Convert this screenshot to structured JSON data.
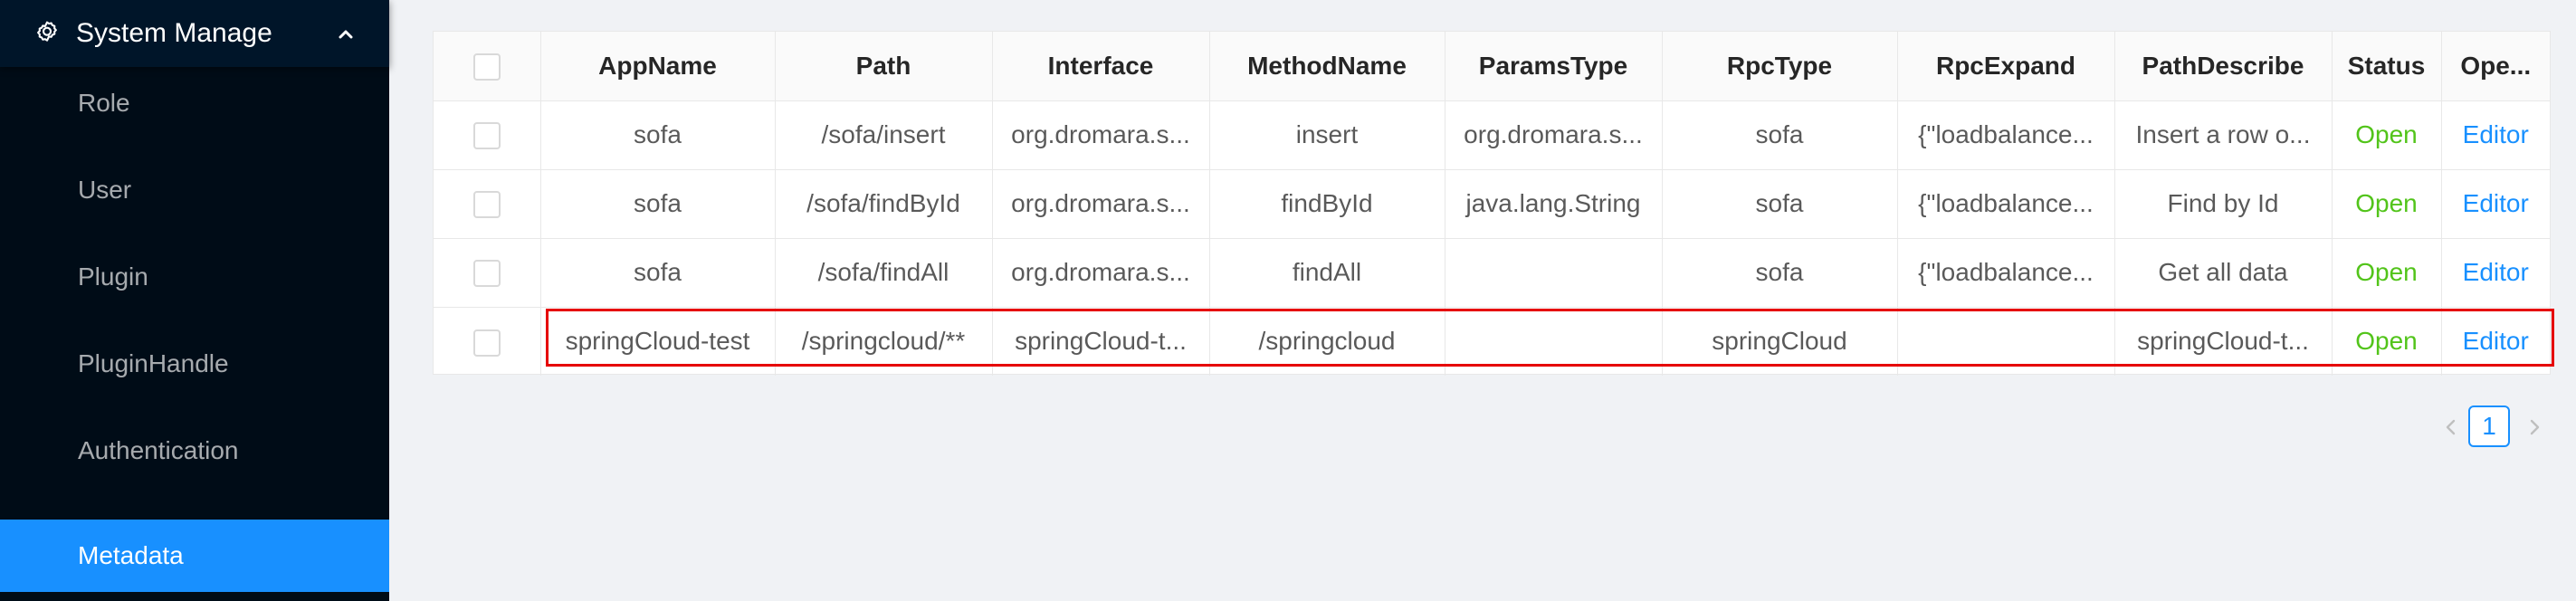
{
  "sidebar": {
    "header": {
      "title": "System Manage",
      "icon": "gear-icon",
      "caret_icon": "chevron-up-icon"
    },
    "items": [
      {
        "label": "Role",
        "selected": false
      },
      {
        "label": "User",
        "selected": false
      },
      {
        "label": "Plugin",
        "selected": false
      },
      {
        "label": "PluginHandle",
        "selected": false
      },
      {
        "label": "Authentication",
        "selected": false
      },
      {
        "label": "Metadata",
        "selected": true
      }
    ],
    "colors": {
      "background": "#001529",
      "selected": "#1890ff"
    }
  },
  "table": {
    "columns": [
      "AppName",
      "Path",
      "Interface",
      "MethodName",
      "ParamsType",
      "RpcType",
      "RpcExpand",
      "PathDescribe",
      "Status",
      "Ope..."
    ],
    "rows": [
      {
        "app_name": "sofa",
        "path": "/sofa/insert",
        "interface": "org.dromara.s...",
        "method_name": "insert",
        "params_type": "org.dromara.s...",
        "rpc_type": "sofa",
        "rpc_expand": "{\"loadbalance...",
        "path_describe": "Insert a row o...",
        "status": "Open",
        "operation": "Editor",
        "highlighted": false
      },
      {
        "app_name": "sofa",
        "path": "/sofa/findById",
        "interface": "org.dromara.s...",
        "method_name": "findById",
        "params_type": "java.lang.String",
        "rpc_type": "sofa",
        "rpc_expand": "{\"loadbalance...",
        "path_describe": "Find by Id",
        "status": "Open",
        "operation": "Editor",
        "highlighted": false
      },
      {
        "app_name": "sofa",
        "path": "/sofa/findAll",
        "interface": "org.dromara.s...",
        "method_name": "findAll",
        "params_type": "",
        "rpc_type": "sofa",
        "rpc_expand": "{\"loadbalance...",
        "path_describe": "Get all data",
        "status": "Open",
        "operation": "Editor",
        "highlighted": false
      },
      {
        "app_name": "springCloud-test",
        "path": "/springcloud/**",
        "interface": "springCloud-t...",
        "method_name": "/springcloud",
        "params_type": "",
        "rpc_type": "springCloud",
        "rpc_expand": "",
        "path_describe": "springCloud-t...",
        "status": "Open",
        "operation": "Editor",
        "highlighted": true
      }
    ],
    "colors": {
      "status_open": "#52c41a",
      "link": "#1890ff",
      "highlight_border": "#e60000"
    }
  },
  "pagination": {
    "current_page": "1",
    "prev_icon": "chevron-left-icon",
    "next_icon": "chevron-right-icon"
  }
}
